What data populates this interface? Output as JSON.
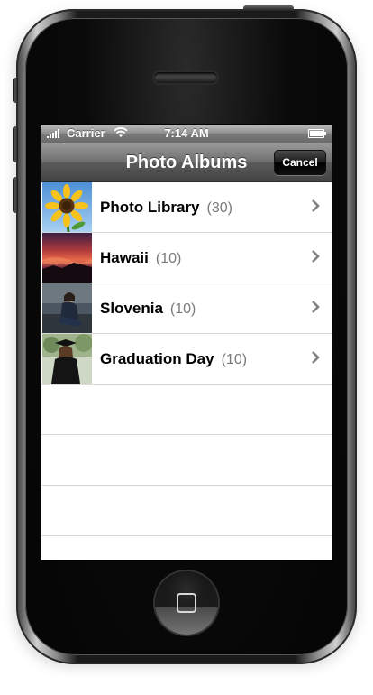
{
  "status_bar": {
    "carrier": "Carrier",
    "time": "7:14 AM",
    "battery_level": 1.0,
    "signal_bars": 5
  },
  "nav_bar": {
    "title": "Photo Albums",
    "cancel_label": "Cancel"
  },
  "albums": [
    {
      "name": "Photo Library",
      "count": "(30)",
      "thumb_icon": "sunflower-thumbnail"
    },
    {
      "name": "Hawaii",
      "count": "(10)",
      "thumb_icon": "sunset-thumbnail"
    },
    {
      "name": "Slovenia",
      "count": "(10)",
      "thumb_icon": "portrait-thumbnail"
    },
    {
      "name": "Graduation Day",
      "count": "(10)",
      "thumb_icon": "graduate-thumbnail"
    }
  ],
  "colors": {
    "nav_gradient_top": "#9a9a9a",
    "nav_gradient_bottom": "#434343",
    "row_separator": "#d9d9d9",
    "count_text": "#7a7a7a"
  }
}
